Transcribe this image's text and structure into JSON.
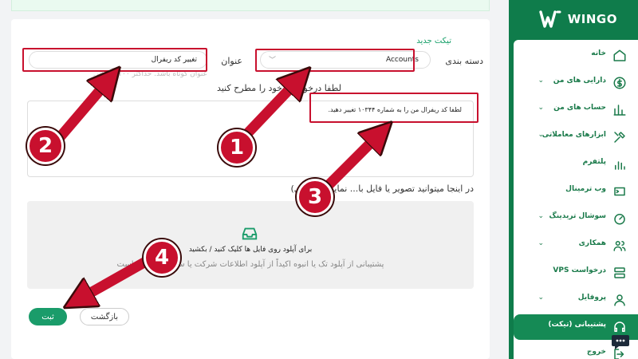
{
  "brand": {
    "name": "WINGO"
  },
  "form": {
    "title": "تیکت جدید",
    "category_label": "دسته بندی",
    "category_value": "Accounts",
    "subject_label": "عنوان",
    "subject_value": "تغییر کد ریفرال",
    "subject_help": "عنوان کوتاه باشد. حداکثر ۱۰۰ کاراکتر.",
    "message_label": "لطفا درخواست خود را مطرح کنید",
    "message_value": "لطفا کد ریفرال من را به شماره ۱۰۳۴۴ تغییر دهید.",
    "attach_label": "در اینجا میتوانید تصویر یا فایل با... نمایید (اختیاری)",
    "upload_main": "برای آپلود روی فایل ها کلیک کنید / بکشید",
    "upload_note": "پشتیبانی از آپلود تک یا انبوه اکیداً از آپلود اطلاعات شرکت یا سایر ... ممنوع است",
    "submit_label": "ثبت",
    "back_label": "بازگشت"
  },
  "annotations": [
    "1",
    "2",
    "3",
    "4"
  ],
  "sidebar": {
    "items": [
      {
        "label": "خانه",
        "icon": "home-icon",
        "chevron": false
      },
      {
        "label": "دارایی های من",
        "icon": "dollar-icon",
        "chevron": true
      },
      {
        "label": "حساب های من",
        "icon": "chart-icon",
        "chevron": true
      },
      {
        "label": "ابزارهای معاملاتی",
        "icon": "tools-icon",
        "chevron": true
      },
      {
        "label": "پلتفرم",
        "icon": "platform-icon",
        "chevron": false
      },
      {
        "label": "وب ترمینال",
        "icon": "terminal-icon",
        "chevron": false
      },
      {
        "label": "سوشال تریدینگ",
        "icon": "speedometer-icon",
        "chevron": true
      },
      {
        "label": "همکاری",
        "icon": "users-icon",
        "chevron": true
      },
      {
        "label": "درخواست VPS",
        "icon": "server-icon",
        "chevron": false
      },
      {
        "label": "پروفایل",
        "icon": "user-icon",
        "chevron": true
      },
      {
        "label": "پشتیبانی (تیکت)",
        "icon": "headset-icon",
        "chevron": false
      },
      {
        "label": "خروج",
        "icon": "logout-icon",
        "chevron": false
      }
    ]
  },
  "colors": {
    "brand_green": "#0f7c4b",
    "accent_red": "#c8102e",
    "submit_green": "#1a9c6a"
  }
}
